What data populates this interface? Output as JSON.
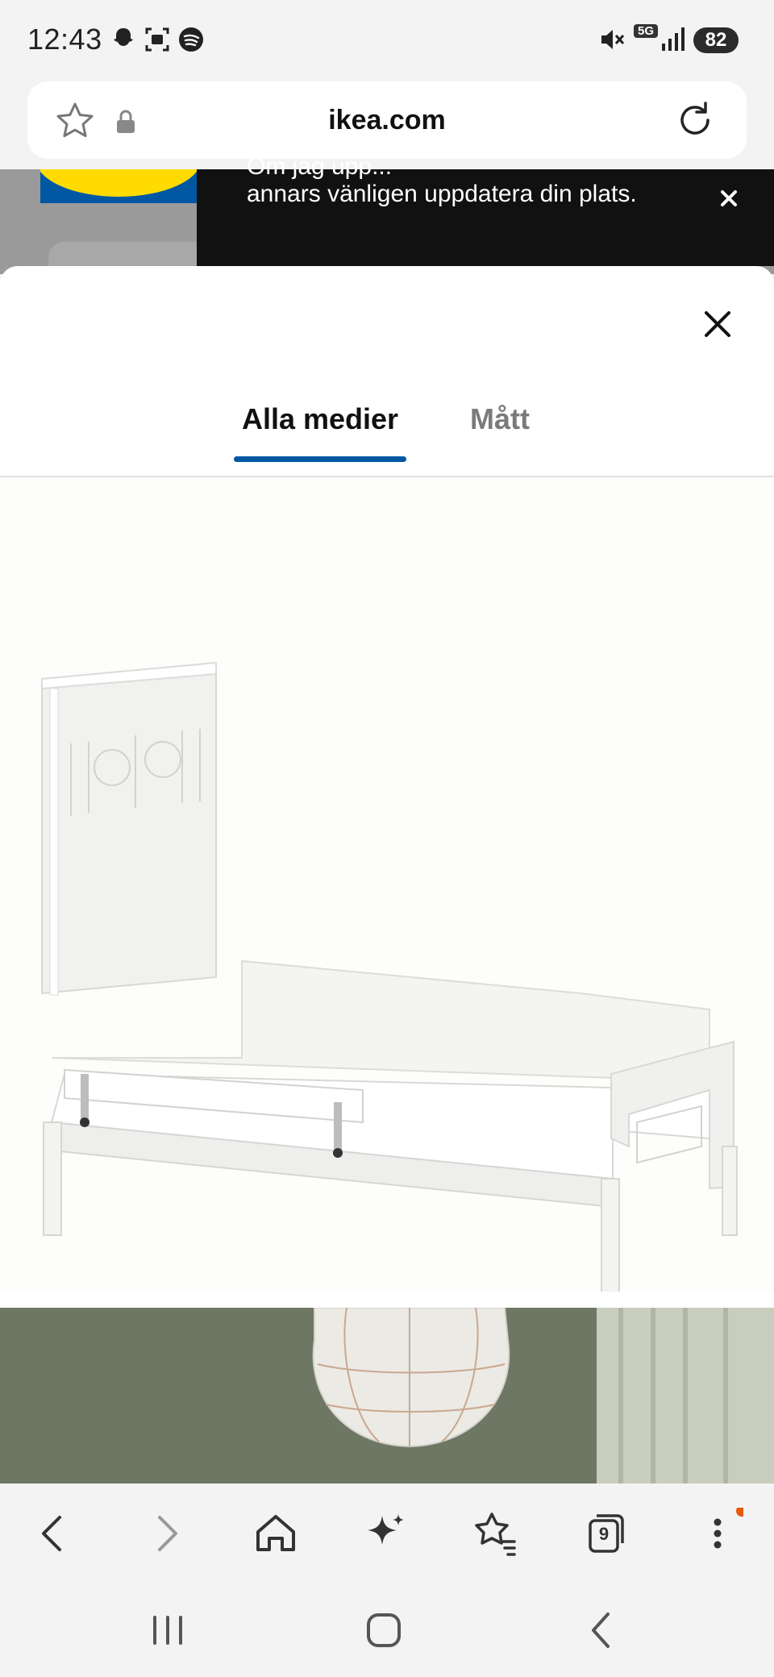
{
  "status_bar": {
    "time": "12:43",
    "battery": "82",
    "network": "5G",
    "icons": [
      "snapchat-icon",
      "screenshot-icon",
      "spotify-icon",
      "mute-icon",
      "network-5g-icon",
      "signal-icon"
    ]
  },
  "browser": {
    "url": "ikea.com",
    "tab_count": "9"
  },
  "toast": {
    "text": "annars vänligen uppdatera din plats.",
    "text_cut_off": "Om jag upp..."
  },
  "modal": {
    "tabs": [
      {
        "label": "Alla medier",
        "selected": true
      },
      {
        "label": "Mått",
        "selected": false
      }
    ]
  },
  "colors": {
    "ikea_blue": "#0058a3",
    "ikea_yellow": "#ffdb00",
    "toast_bg": "#111111",
    "notification_dot": "#e8590c"
  }
}
